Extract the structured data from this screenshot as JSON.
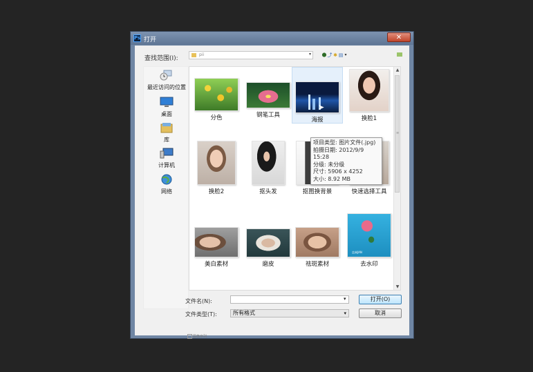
{
  "window": {
    "title": "打开",
    "app_icon": "Ps",
    "close_symbol": "✕"
  },
  "toolbar": {
    "look_in_label": "查找范围(I):",
    "look_in_value": "pii",
    "dropdown_symbol": "▾",
    "back_symbol": "⬤",
    "up_symbol": "⤴",
    "new_folder_symbol": "✱",
    "view_menu_symbol": "▤"
  },
  "places": [
    {
      "label": "最近访问的位置",
      "icon": "recent-places-icon"
    },
    {
      "label": "桌面",
      "icon": "desktop-icon"
    },
    {
      "label": "库",
      "icon": "libraries-icon"
    },
    {
      "label": "计算机",
      "icon": "computer-icon"
    },
    {
      "label": "网络",
      "icon": "network-icon"
    }
  ],
  "files": [
    {
      "name": "分色",
      "color": "#7bb245"
    },
    {
      "name": "钢笔工具",
      "color": "#d9567b"
    },
    {
      "name": "海报",
      "color": "#1b3b72"
    },
    {
      "name": "换脸1",
      "color": "#c89a86"
    },
    {
      "name": "换脸2",
      "color": "#cbb3a5"
    },
    {
      "name": "抠头发",
      "color": "#d8d8d8"
    },
    {
      "name": "抠图换背景",
      "color": "#4b4b4b"
    },
    {
      "name": "快速选择工具",
      "color": "#a89a8f"
    },
    {
      "name": "美白素材",
      "color": "#a88875"
    },
    {
      "name": "磨皮",
      "color": "#b9b2a7"
    },
    {
      "name": "祛斑素材",
      "color": "#c49f88"
    },
    {
      "name": "去水印",
      "color": "#2a9fcf"
    }
  ],
  "tooltip": {
    "type": "项目类型: 图片文件(.jpg)",
    "date": "拍摄日期: 2012/9/9 15:28",
    "rating": "分级: 未分级",
    "size": "尺寸: 5906 x 4252",
    "filesize": "大小: 8.92 MB"
  },
  "file_name": {
    "label": "文件名(N):",
    "value": ""
  },
  "file_type": {
    "label": "文件类型(T):",
    "value": "所有格式"
  },
  "buttons": {
    "open": "打开(O)",
    "cancel": "取消"
  },
  "preview_label": "图像序列",
  "watermark": "吉米JAN"
}
